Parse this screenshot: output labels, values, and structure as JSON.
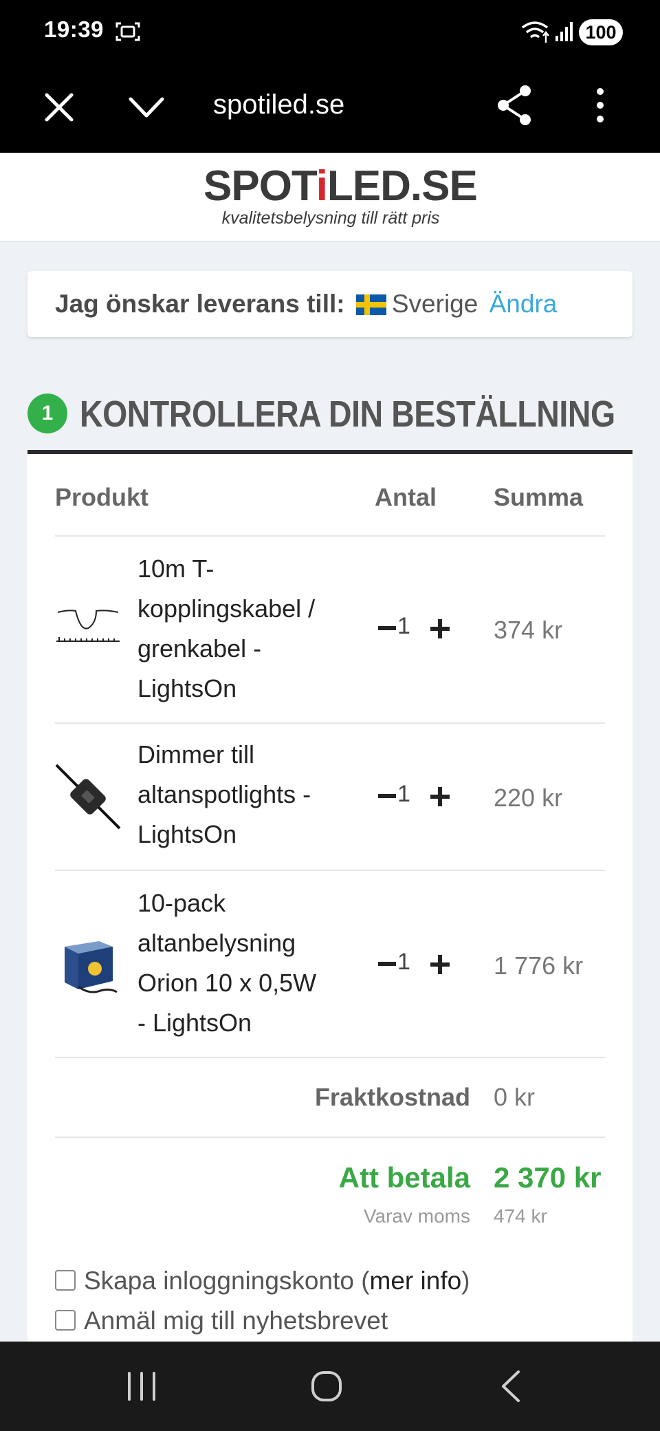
{
  "status_bar": {
    "time": "19:39",
    "battery": "100",
    "icons": [
      "screenshot-icon",
      "wifi-icon",
      "signal-icon"
    ]
  },
  "browser": {
    "url": "spotiled.se",
    "icons": [
      "close-icon",
      "chevron-down-icon",
      "share-icon",
      "more-vert-icon"
    ]
  },
  "logo": {
    "part1": "SPOT",
    "part_red": "i",
    "part2": "LED.SE",
    "tagline": "kvalitetsbelysning till rätt pris"
  },
  "delivery": {
    "label": "Jag önskar leverans till:",
    "country": "Sverige",
    "change_link": "Ändra",
    "flag_icon": "sweden-flag-icon"
  },
  "step": {
    "number": "1",
    "title": "KONTROLLERA DIN BESTÄLLNING",
    "accent": "#34b04a"
  },
  "table": {
    "headers": {
      "product": "Produkt",
      "quantity": "Antal",
      "sum": "Summa"
    },
    "rows": [
      {
        "name": "10m T-kopplingskabel / grenkabel - LightsOn",
        "name_lines": [
          "10m T-",
          "kopplingskabel /",
          "grenkabel -",
          "LightsOn"
        ],
        "quantity": "1",
        "price": "374 kr",
        "icon": "cable-thumbnail"
      },
      {
        "name": "Dimmer till altanspotlights - LightsOn",
        "name_lines": [
          "Dimmer till",
          "altanspotlights -",
          "LightsOn"
        ],
        "quantity": "1",
        "price": "220 kr",
        "icon": "dimmer-thumbnail"
      },
      {
        "name": "10-pack altanbelysning Orion 10 x 0,5W - LightsOn",
        "name_lines": [
          "10-pack",
          "altanbelysning",
          "Orion 10 x 0,5W",
          "- LightsOn"
        ],
        "quantity": "1",
        "price": "1 776 kr",
        "icon": "box-thumbnail"
      }
    ]
  },
  "totals": {
    "shipping_label": "Fraktkostnad",
    "shipping_value": "0 kr",
    "pay_label": "Att betala",
    "pay_value": "2 370 kr",
    "vat_label": "Varav moms",
    "vat_value": "474 kr",
    "pay_color": "#3aa845"
  },
  "options": {
    "create_account_prefix": "Skapa inloggningskonto (",
    "create_account_link": "mer info",
    "create_account_suffix": ")",
    "newsletter": "Anmäl mig till nyhetsbrevet"
  },
  "nav": {
    "icons": [
      "recent-apps-icon",
      "home-icon",
      "back-icon"
    ]
  }
}
